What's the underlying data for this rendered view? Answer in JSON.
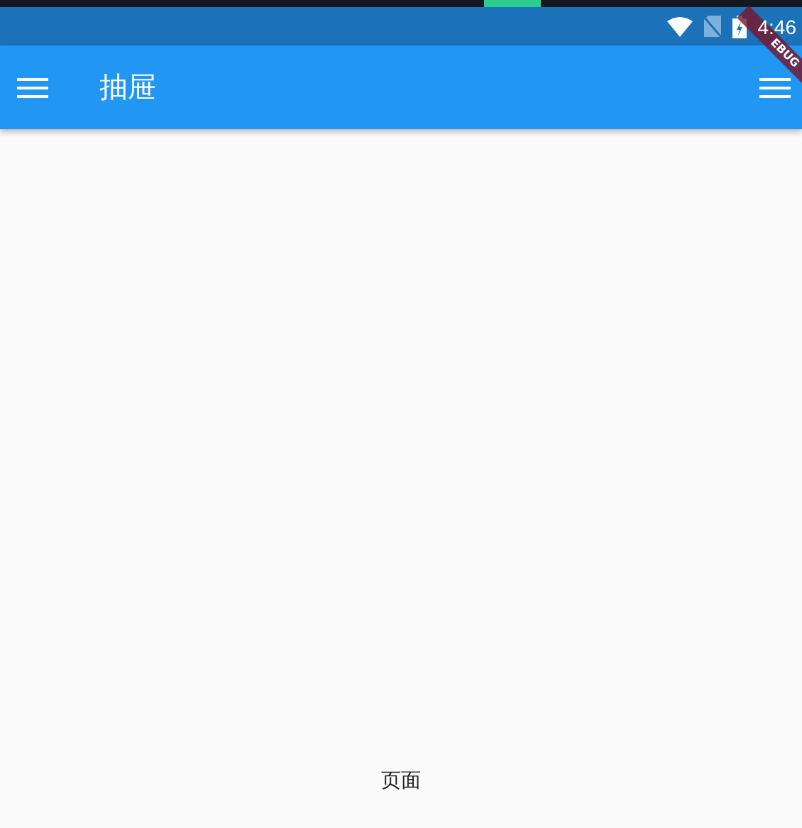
{
  "status_bar": {
    "time": "4:46"
  },
  "debug_banner": {
    "label": "EBUG"
  },
  "app_bar": {
    "title": "抽屉"
  },
  "body": {
    "text": "页面"
  }
}
